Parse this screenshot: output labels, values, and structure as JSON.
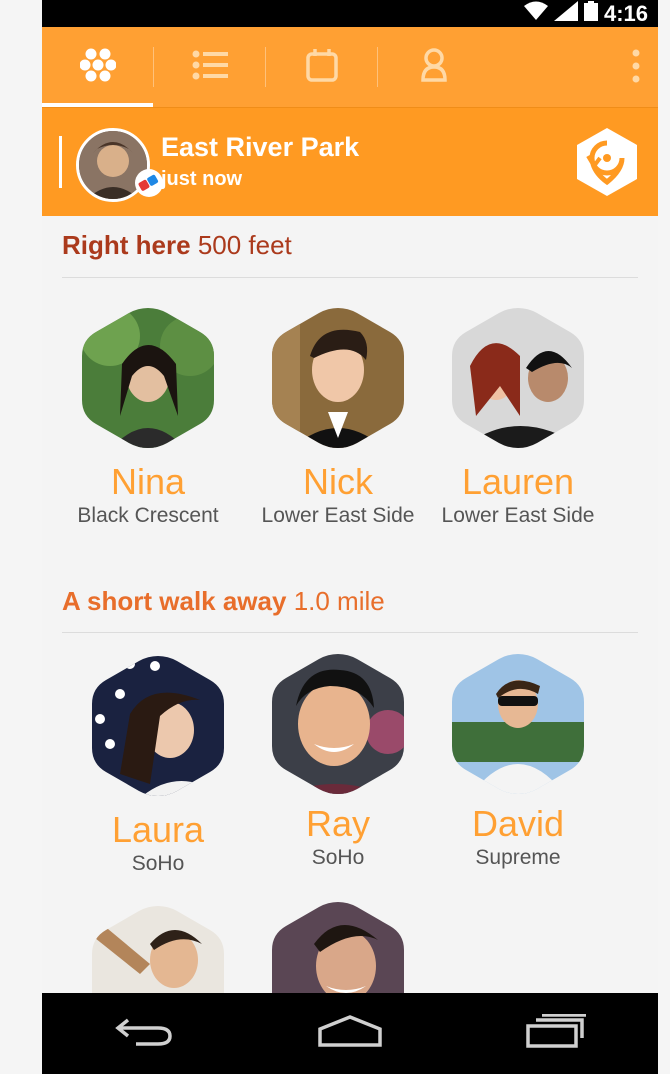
{
  "status_bar": {
    "time": "4:16"
  },
  "tabs": [
    {
      "icon": "hexagon-grid-icon",
      "active": true
    },
    {
      "icon": "list-icon",
      "active": false
    },
    {
      "icon": "calendar-icon",
      "active": false
    },
    {
      "icon": "person-icon",
      "active": false
    }
  ],
  "overflow_icon": "more-vert-icon",
  "checkin": {
    "place": "East River Park",
    "time": "just now"
  },
  "sections": [
    {
      "title": "Right here",
      "distance": "500 feet",
      "people": [
        {
          "name": "Nina",
          "location": "Black Crescent"
        },
        {
          "name": "Nick",
          "location": "Lower East Side"
        },
        {
          "name": "Lauren",
          "location": "Lower East Side"
        }
      ]
    },
    {
      "title": "A short walk away",
      "distance": "1.0 mile",
      "people": [
        {
          "name": "Laura",
          "location": "SoHo"
        },
        {
          "name": "Ray",
          "location": "SoHo"
        },
        {
          "name": "David",
          "location": "Supreme"
        }
      ]
    }
  ],
  "colors": {
    "accent": "#ffa033",
    "banner": "#ff9a22",
    "title_dark": "#ab3a1c",
    "title_orange": "#e86e2b"
  },
  "nav_buttons": [
    "back-icon",
    "home-icon",
    "recents-icon"
  ]
}
